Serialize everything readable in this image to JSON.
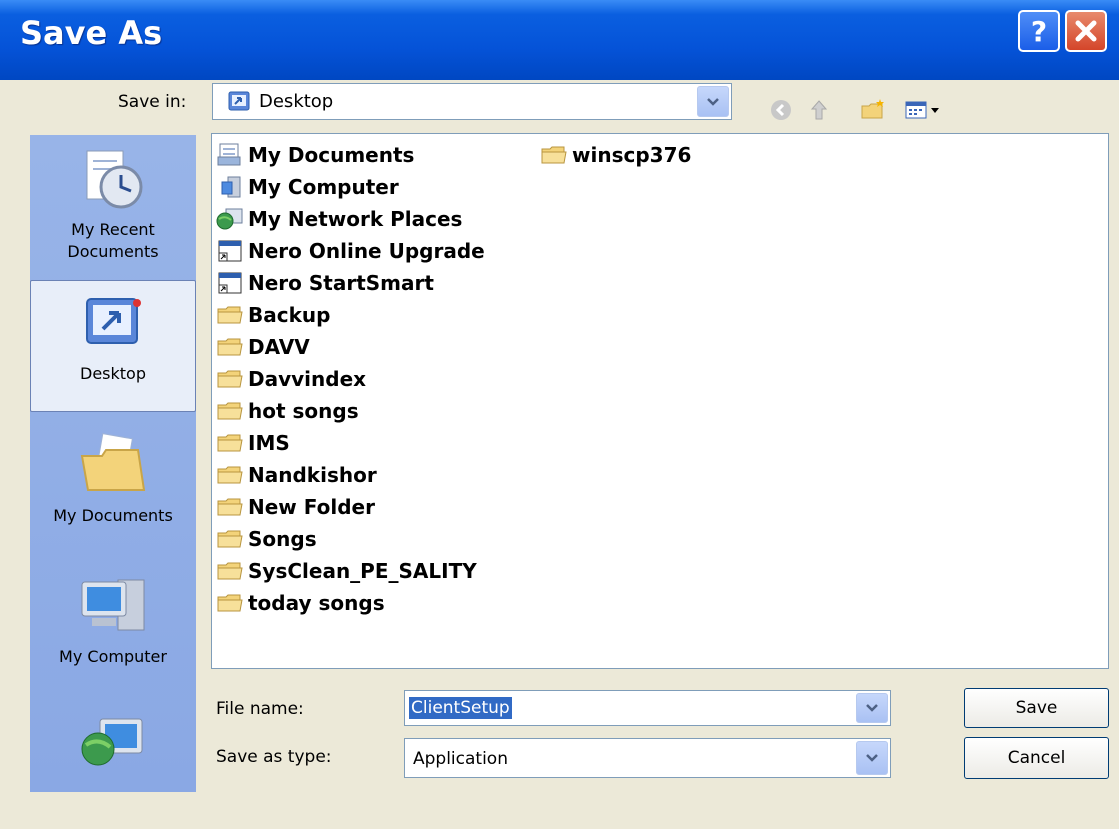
{
  "window": {
    "title": "Save As"
  },
  "save_in": {
    "label": "Save in:",
    "value": "Desktop"
  },
  "places": [
    {
      "label_line1": "My Recent",
      "label_line2": "Documents",
      "icon": "recent-documents-icon"
    },
    {
      "label_line1": "Desktop",
      "label_line2": "",
      "icon": "desktop-icon"
    },
    {
      "label_line1": "My Documents",
      "label_line2": "",
      "icon": "my-documents-icon"
    },
    {
      "label_line1": "My Computer",
      "label_line2": "",
      "icon": "my-computer-icon"
    },
    {
      "label_line1": "",
      "label_line2": "",
      "icon": "network-places-icon"
    }
  ],
  "files": [
    {
      "name": "My Documents",
      "icon": "my-documents-icon"
    },
    {
      "name": "My Computer",
      "icon": "computer-icon"
    },
    {
      "name": "My Network Places",
      "icon": "network-icon"
    },
    {
      "name": "Nero Online Upgrade",
      "icon": "shortcut-icon"
    },
    {
      "name": "Nero StartSmart",
      "icon": "shortcut-icon"
    },
    {
      "name": "Backup",
      "icon": "folder-icon"
    },
    {
      "name": "DAVV",
      "icon": "folder-icon"
    },
    {
      "name": "Davvindex",
      "icon": "folder-icon"
    },
    {
      "name": "hot songs",
      "icon": "folder-icon"
    },
    {
      "name": "IMS",
      "icon": "folder-icon"
    },
    {
      "name": "Nandkishor",
      "icon": "folder-icon"
    },
    {
      "name": "New Folder",
      "icon": "folder-icon"
    },
    {
      "name": "Songs",
      "icon": "folder-icon"
    },
    {
      "name": "SysClean_PE_SALITY",
      "icon": "folder-icon"
    },
    {
      "name": "today songs",
      "icon": "folder-icon"
    },
    {
      "name": "winscp376",
      "icon": "folder-icon"
    }
  ],
  "file_name": {
    "label": "File name:",
    "value": "ClientSetup"
  },
  "save_as_type": {
    "label": "Save as type:",
    "value": "Application"
  },
  "buttons": {
    "save": "Save",
    "cancel": "Cancel"
  },
  "colors": {
    "title_bar": "#0553d8",
    "places_bar": "#8aa8e4",
    "selection": "#316ac5",
    "folder": "#f3d37a"
  }
}
